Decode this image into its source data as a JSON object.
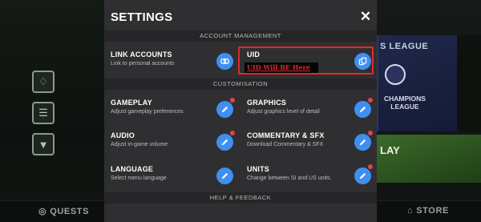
{
  "modal": {
    "title": "SETTINGS",
    "close_icon": "close-icon"
  },
  "sections": {
    "account": "ACCOUNT MANAGEMENT",
    "customisation": "CUSTOMISATION",
    "help": "HELP & FEEDBACK"
  },
  "account": {
    "link_accounts": {
      "title": "LINK ACCOUNTS",
      "subtitle": "Link to personal accounts",
      "icon": "link-icon"
    },
    "uid": {
      "title": "UID",
      "value": "UID Will BE Here",
      "icon": "copy-icon"
    }
  },
  "settings": [
    {
      "title": "GAMEPLAY",
      "subtitle": "Adjust gameplay preferences",
      "icon": "pencil-icon",
      "notify": true
    },
    {
      "title": "GRAPHICS",
      "subtitle": "Adjust graphics level of detail",
      "icon": "pencil-icon",
      "notify": true
    },
    {
      "title": "AUDIO",
      "subtitle": "Adjust in-game volume",
      "icon": "pencil-icon",
      "notify": true
    },
    {
      "title": "COMMENTARY & SFX",
      "subtitle": "Download Commentary & SFX",
      "icon": "pencil-icon",
      "notify": true
    },
    {
      "title": "LANGUAGE",
      "subtitle": "Select menu language",
      "icon": "pencil-icon",
      "notify": false
    },
    {
      "title": "UNITS",
      "subtitle": "Change between SI and US units.",
      "icon": "pencil-icon",
      "notify": true
    }
  ],
  "background": {
    "league_text": "S LEAGUE",
    "ucl_caption": "CHAMPIONS LEAGUE",
    "play_text": "LAY",
    "nav_quests": "QUESTS",
    "nav_store": "STORE"
  },
  "colors": {
    "modal_bg": "#2f2f31",
    "accent_blue": "#3f8ff2",
    "notify_red": "#e0444b",
    "highlight_red": "#e02a2a"
  }
}
